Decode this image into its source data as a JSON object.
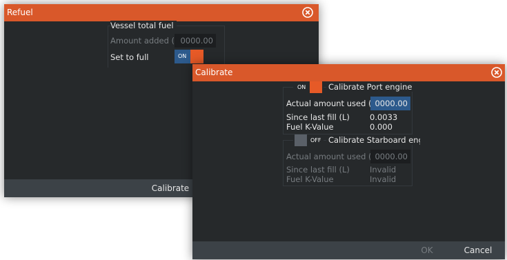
{
  "refuel": {
    "title": "Refuel",
    "section_label": "Vessel total fuel",
    "amount_added_label": "Amount added (L)",
    "amount_added_value": "0000.00",
    "set_to_full_label": "Set to full",
    "set_to_full_state": "ON",
    "footer_button": "Calibrate"
  },
  "calibrate": {
    "title": "Calibrate",
    "port": {
      "toggle_state": "ON",
      "label": "Calibrate Port engine",
      "actual_label": "Actual amount used (L)",
      "actual_value": "0000.00",
      "since_label": "Since last fill (L)",
      "since_value": "0.0033",
      "k_label": "Fuel K-Value",
      "k_value": "0.000"
    },
    "starboard": {
      "toggle_state": "OFF",
      "label": "Calibrate Starboard engine",
      "actual_label": "Actual amount used (L)",
      "actual_value": "0000.00",
      "since_label": "Since last fill (L)",
      "since_value": "Invalid",
      "k_label": "Fuel K-Value",
      "k_value": "Invalid"
    },
    "ok_label": "OK",
    "cancel_label": "Cancel"
  },
  "colors": {
    "title_bar": "#d9582a",
    "dialog_bg": "#26292b",
    "footer_bg": "#3c4247",
    "toggle_on": "#e65a27",
    "toggle_blue": "#2d5a8c"
  }
}
